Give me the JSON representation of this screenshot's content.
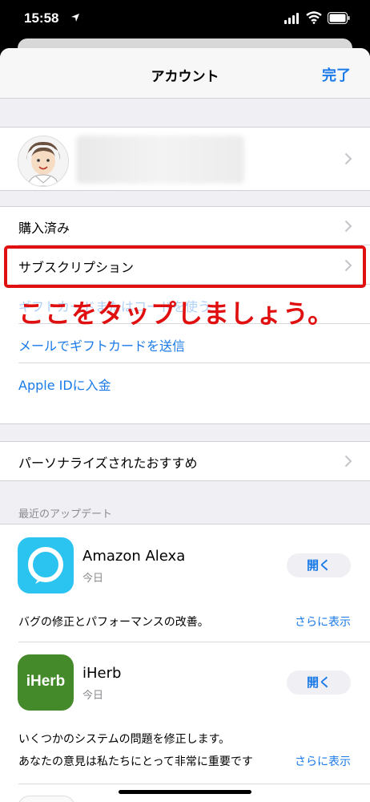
{
  "status_bar": {
    "time": "15:58"
  },
  "nav": {
    "title": "アカウント",
    "done_label": "完了"
  },
  "profile": {
    "avatar_icon": "avatar-face"
  },
  "menu": {
    "purchased": "購入済み",
    "subscriptions": "サブスクリプション",
    "hidden_link": "ギフトカードまたはコードを使う",
    "send_gift_card": "メールでギフトカードを送信",
    "add_funds": "Apple IDに入金",
    "personalized": "パーソナライズされたおすすめ"
  },
  "annotation": {
    "text": "ここをタップしましょう。",
    "color": "#e01010"
  },
  "updates": {
    "header": "最近のアップデート",
    "apps": [
      {
        "name": "Amazon Alexa",
        "date": "今日",
        "open_label": "開く",
        "desc_line1": "バグの修正とパフォーマンスの改善。",
        "desc_line2": "",
        "more_label": "さらに表示",
        "icon": "alexa-icon"
      },
      {
        "name": "iHerb",
        "date": "今日",
        "open_label": "開く",
        "desc_line1": "いくつかのシステムの問題を修正します。",
        "desc_line2": "あなたの意見は私たちにとって非常に重要です",
        "more_label": "さらに表示",
        "icon": "iherb-icon",
        "icon_text": "iHerb"
      }
    ]
  },
  "colors": {
    "accent": "#1a7ae8",
    "highlight": "#e01010",
    "alexa": "#2bc4f0",
    "iherb": "#458a2a"
  }
}
